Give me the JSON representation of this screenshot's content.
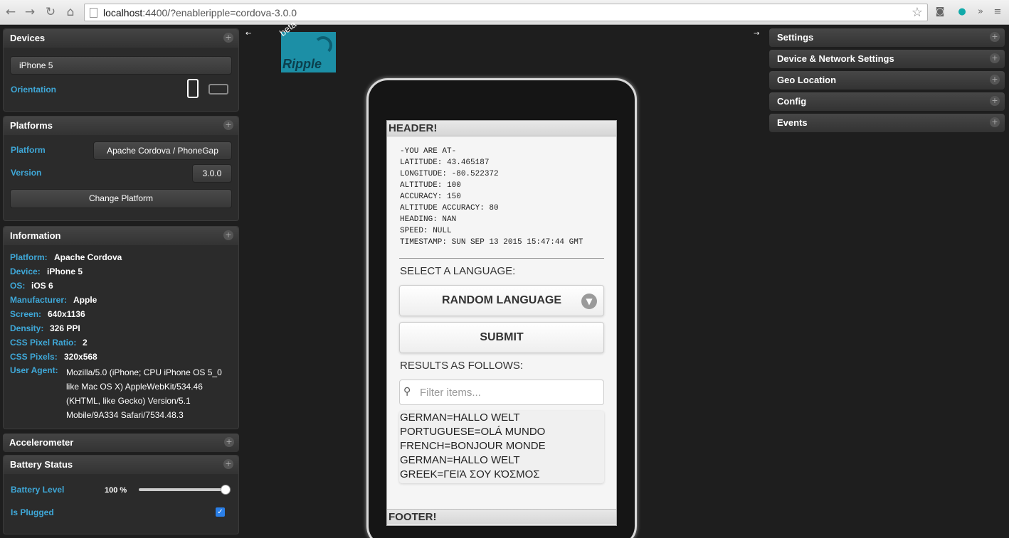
{
  "browser": {
    "url_host": "localhost",
    "url_rest": ":4400/?enableripple=cordova-3.0.0"
  },
  "left": {
    "devices": {
      "title": "Devices",
      "device": "iPhone 5",
      "orientation_label": "Orientation"
    },
    "platforms": {
      "title": "Platforms",
      "platform_label": "Platform",
      "platform_value": "Apache Cordova / PhoneGap",
      "version_label": "Version",
      "version_value": "3.0.0",
      "change_button": "Change Platform"
    },
    "information": {
      "title": "Information",
      "rows": [
        {
          "label": "Platform:",
          "value": "Apache Cordova"
        },
        {
          "label": "Device:",
          "value": "iPhone 5"
        },
        {
          "label": "OS:",
          "value": "iOS 6"
        },
        {
          "label": "Manufacturer:",
          "value": "Apple"
        },
        {
          "label": "Screen:",
          "value": "640x1136"
        },
        {
          "label": "Density:",
          "value": "326 PPI"
        },
        {
          "label": "CSS Pixel Ratio:",
          "value": "2"
        },
        {
          "label": "CSS Pixels:",
          "value": "320x568"
        }
      ],
      "ua_label": "User Agent:",
      "ua_lines": [
        "Mozilla/5.0 (iPhone; CPU iPhone OS 5_0",
        "like Mac OS X) AppleWebKit/534.46",
        "(KHTML, like Gecko) Version/5.1",
        "Mobile/9A334 Safari/7534.48.3"
      ]
    },
    "accelerometer": {
      "title": "Accelerometer"
    },
    "battery": {
      "title": "Battery Status",
      "level_label": "Battery Level",
      "level_value": "100 %",
      "level": 1.0,
      "plugged_label": "Is Plugged"
    }
  },
  "logo": {
    "beta": "beta",
    "name": "Ripple"
  },
  "right": {
    "panels": [
      "Settings",
      "Device & Network Settings",
      "Geo Location",
      "Config",
      "Events"
    ]
  },
  "screen": {
    "header": "HEADER!",
    "footer": "FOOTER!",
    "geo_lines": [
      "-YOU ARE AT-",
      "LATITUDE: 43.465187",
      "LONGITUDE: -80.522372",
      "ALTITUDE: 100",
      "ACCURACY: 150",
      "ALTITUDE ACCURACY: 80",
      "HEADING: NAN",
      "SPEED: NULL",
      "TIMESTAMP: SUN SEP 13 2015 15:47:44 GMT"
    ],
    "select_label": "SELECT A LANGUAGE:",
    "select_value": "RANDOM LANGUAGE",
    "submit": "SUBMIT",
    "results_label": "RESULTS AS FOLLOWS:",
    "filter_placeholder": "Filter items...",
    "results": [
      "GERMAN=HALLO WELT",
      "PORTUGUESE=OLÁ MUNDO",
      "FRENCH=BONJOUR MONDE",
      "GERMAN=HALLO WELT",
      "GREEK=ΓΕΙΆ ΣΟΥ ΚΌΣΜΟΣ"
    ]
  }
}
